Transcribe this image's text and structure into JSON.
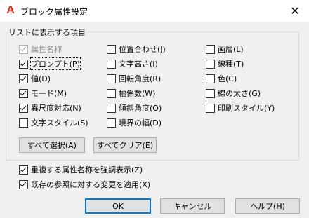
{
  "window": {
    "title": "ブロック属性設定",
    "app_icon": "A"
  },
  "group_label": "リストに表示する項目",
  "checkboxes": [
    {
      "label": "属性名称",
      "checked": true,
      "disabled": true
    },
    {
      "label": "プロンプト(P)",
      "checked": true,
      "focused": true
    },
    {
      "label": "値(D)",
      "checked": true
    },
    {
      "label": "モード(M)",
      "checked": true
    },
    {
      "label": "異尺度対応(N)",
      "checked": true
    },
    {
      "label": "文字スタイル(S)",
      "checked": false
    },
    {
      "label": "位置合わせ(J)",
      "checked": false
    },
    {
      "label": "文字高さ(I)",
      "checked": false
    },
    {
      "label": "回転角度(R)",
      "checked": false
    },
    {
      "label": "幅係数(W)",
      "checked": false
    },
    {
      "label": "傾斜角度(O)",
      "checked": false
    },
    {
      "label": "境界の幅(D)",
      "checked": false
    },
    {
      "label": "画層(L)",
      "checked": false
    },
    {
      "label": "線種(T)",
      "checked": false
    },
    {
      "label": "色(C)",
      "checked": false
    },
    {
      "label": "線の太さ(G)",
      "checked": false
    },
    {
      "label": "印刷スタイル(Y)",
      "checked": false
    }
  ],
  "select_all_label": "すべて選択(A)",
  "clear_all_label": "すべてクリア(E)",
  "highlight_duplicates": {
    "label": "重複する属性名称を強調表示(Z)",
    "checked": true
  },
  "apply_changes": {
    "label": "既存の参照に対する変更を適用(X)",
    "checked": true
  },
  "ok_label": "OK",
  "cancel_label": "キャンセル",
  "help_label": "ヘルプ(H)"
}
